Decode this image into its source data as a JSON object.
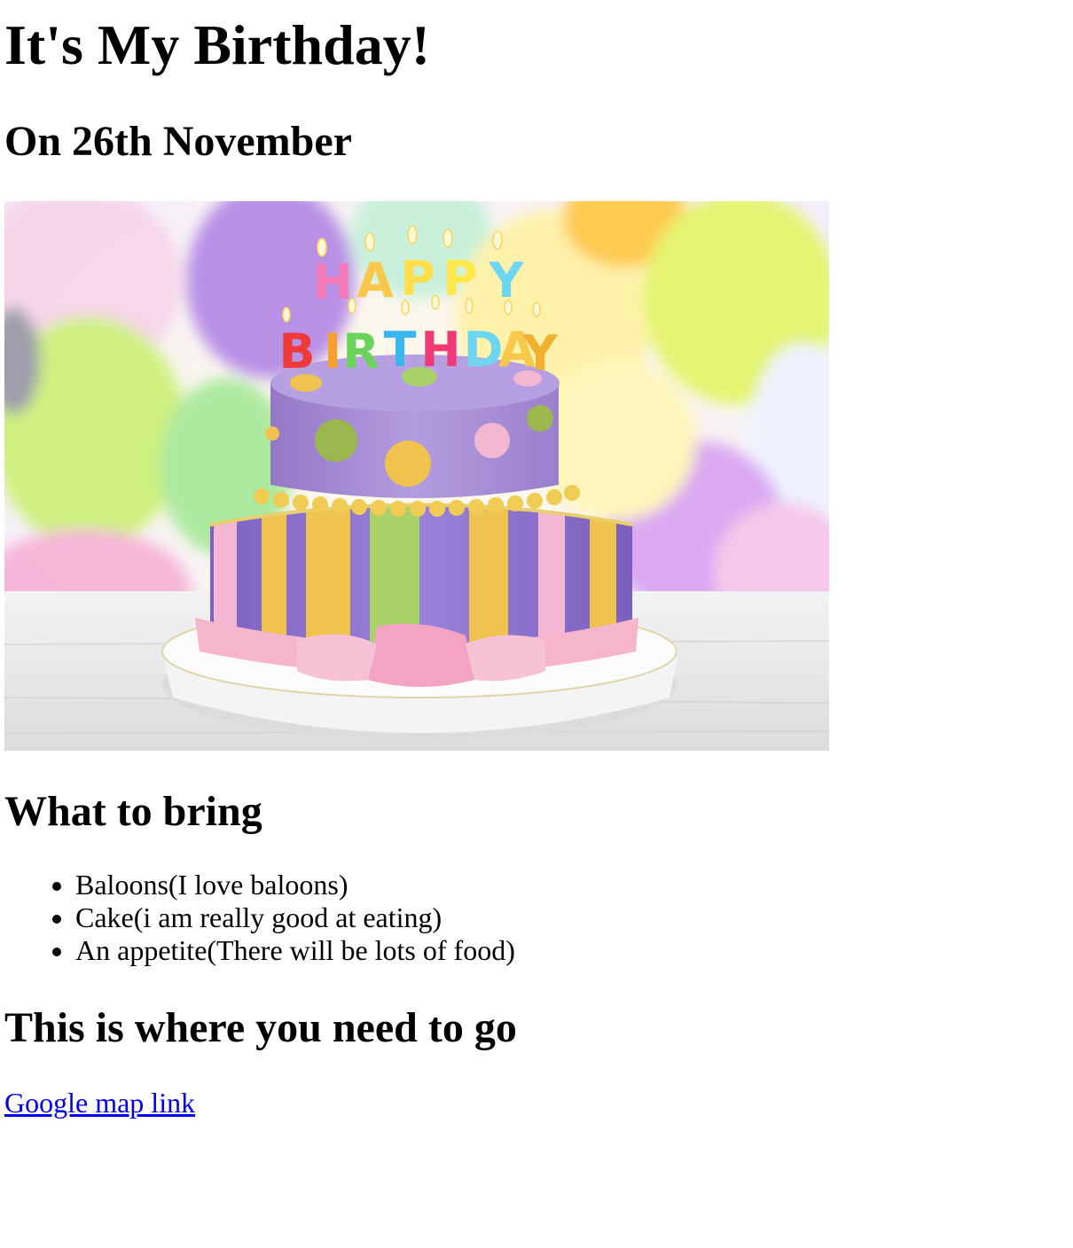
{
  "header": {
    "title": "It's My Birthday!",
    "subtitle": "On 26th November"
  },
  "hero_image": {
    "alt": "",
    "cake_topper_text": "HAPPY BIRTHDAY",
    "colors": {
      "background_tint": "#f3ecff",
      "cake_top": "#a88cd6",
      "cake_bottom": "#8e74d2",
      "stripe_yellow": "#f0c24e",
      "stripe_green": "#a8d16a",
      "stripe_pink": "#f4b7d1",
      "ribbon_pink": "#f6b4cd",
      "plate": "#f8f8f8",
      "table": "#e9e9ea"
    }
  },
  "bring_section": {
    "heading": "What to bring",
    "items": [
      "Baloons(I love baloons)",
      "Cake(i am really good at eating)",
      "An appetite(There will be lots of food)"
    ]
  },
  "where_section": {
    "heading": "This is where you need to go",
    "link_label": "Google map link",
    "link_color": "#0000ee"
  }
}
